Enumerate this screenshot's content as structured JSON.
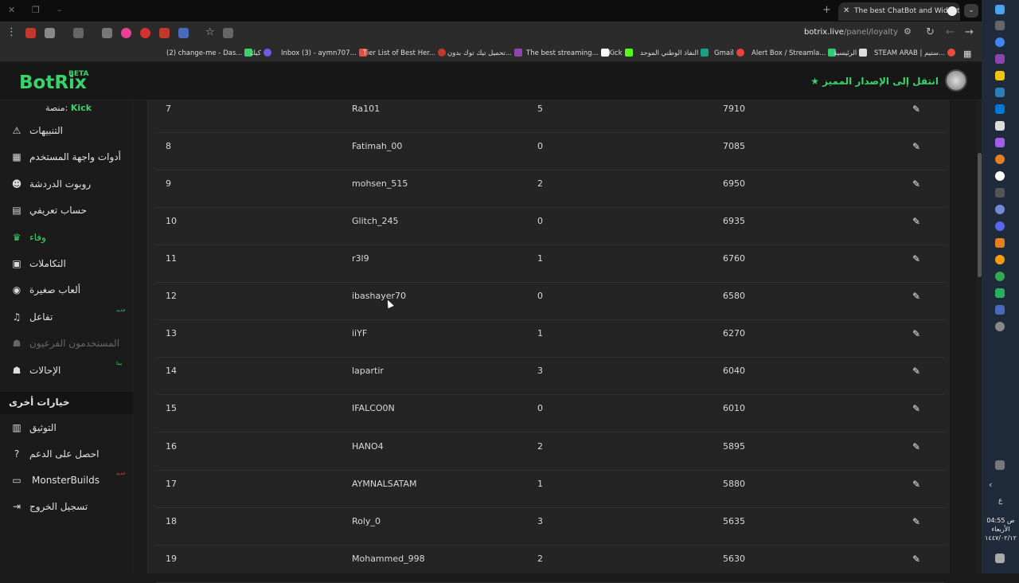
{
  "browser": {
    "tab_title": "The best ChatBot and Widgets",
    "url_host": "botrix.live",
    "url_path": "/panel/loyalty",
    "bookmarks": [
      {
        "label": "(2) change-me - Das...",
        "color": "#3ad36b"
      },
      {
        "label": "كيك",
        "color": "#6c5ce7"
      },
      {
        "label": "Inbox (3) - aymn707...",
        "color": "#e74c3c"
      },
      {
        "label": "Tier List of Best Her...",
        "color": "#c0392b"
      },
      {
        "label": "تحميل تيك توك بدون...",
        "color": "#8e44ad"
      },
      {
        "label": "The best streaming...",
        "color": "#ffffff"
      },
      {
        "label": "Kick",
        "color": "#53fc18"
      },
      {
        "label": "النفاذ الوطني الموحد",
        "color": "#16a085"
      },
      {
        "label": "Gmail",
        "color": "#ea4335"
      },
      {
        "label": "Alert Box / Streamla...",
        "color": "#2ecc71"
      },
      {
        "label": "الرئيسية",
        "color": "#dddddd"
      },
      {
        "label": "STEAM ARAB | ستيم...",
        "color": "#e74c3c"
      }
    ]
  },
  "header": {
    "logo": "BotRix",
    "logo_badge": "BETA",
    "premium_link": "انتقل إلى الإصدار المميز"
  },
  "sidebar": {
    "platform_label": "منصة:",
    "platform_value": "Kick",
    "items": [
      {
        "label": "التنبيهات",
        "icon": "warning-icon",
        "glyph": "⚠"
      },
      {
        "label": "أدوات واجهة المستخدم",
        "icon": "grid-icon",
        "glyph": "▦"
      },
      {
        "label": "روبوت الدردشة",
        "icon": "robot-icon",
        "glyph": "☻"
      },
      {
        "label": "حساب تعريفي",
        "icon": "id-card-icon",
        "glyph": "▤"
      },
      {
        "label": "وفاء",
        "icon": "trophy-icon",
        "glyph": "♛"
      },
      {
        "label": "التكاملات",
        "icon": "chat-icon",
        "glyph": "▣"
      },
      {
        "label": "ألعاب صغيرة",
        "icon": "gamepad-icon",
        "glyph": "◉"
      },
      {
        "label": "تفاعل",
        "icon": "music-icon",
        "glyph": "♫",
        "badge": "جديد"
      },
      {
        "label": "المستخدمون الفرعيون",
        "icon": "users-icon",
        "glyph": "☗"
      },
      {
        "label": "الإحالات",
        "icon": "referral-icon",
        "glyph": "☗",
        "badge": "بيتا"
      }
    ],
    "section_title": "خيارات أخرى",
    "other_items": [
      {
        "label": "التوثيق",
        "icon": "book-icon",
        "glyph": "▥"
      },
      {
        "label": "احصل على الدعم",
        "icon": "question-icon",
        "glyph": "?"
      },
      {
        "label": "MonsterBuilds",
        "icon": "laptop-icon",
        "glyph": "▭",
        "badge": "جديد"
      },
      {
        "label": "تسجيل الخروج",
        "icon": "logout-icon",
        "glyph": "⇥"
      }
    ]
  },
  "loyalty_table": {
    "rows": [
      {
        "rank": "7",
        "name": "Ra101",
        "count": "5",
        "points": "7910"
      },
      {
        "rank": "8",
        "name": "Fatimah_00",
        "count": "0",
        "points": "7085"
      },
      {
        "rank": "9",
        "name": "mohsen_515",
        "count": "2",
        "points": "6950"
      },
      {
        "rank": "10",
        "name": "Glitch_245",
        "count": "0",
        "points": "6935"
      },
      {
        "rank": "11",
        "name": "r3l9",
        "count": "1",
        "points": "6760"
      },
      {
        "rank": "12",
        "name": "ibashayer70",
        "count": "0",
        "points": "6580"
      },
      {
        "rank": "13",
        "name": "iiYF",
        "count": "1",
        "points": "6270"
      },
      {
        "rank": "14",
        "name": "lapartir",
        "count": "3",
        "points": "6040"
      },
      {
        "rank": "15",
        "name": "IFALCO0N",
        "count": "0",
        "points": "6010"
      },
      {
        "rank": "16",
        "name": "HANO4",
        "count": "2",
        "points": "5895"
      },
      {
        "rank": "17",
        "name": "AYMNALSATAM",
        "count": "1",
        "points": "5880"
      },
      {
        "rank": "18",
        "name": "Roly_0",
        "count": "3",
        "points": "5635"
      },
      {
        "rank": "19",
        "name": "Mohammed_998",
        "count": "2",
        "points": "5630"
      }
    ],
    "edit_glyph": "✎"
  },
  "taskbar": {
    "time": "04:55 ص",
    "day": "الأربعاء",
    "date": "١٤٤٧/٠٢/١٢",
    "lang": "ع"
  },
  "colors": {
    "accent": "#3ad36b",
    "background": "#1b1b1b",
    "table_bg": "#242424"
  }
}
